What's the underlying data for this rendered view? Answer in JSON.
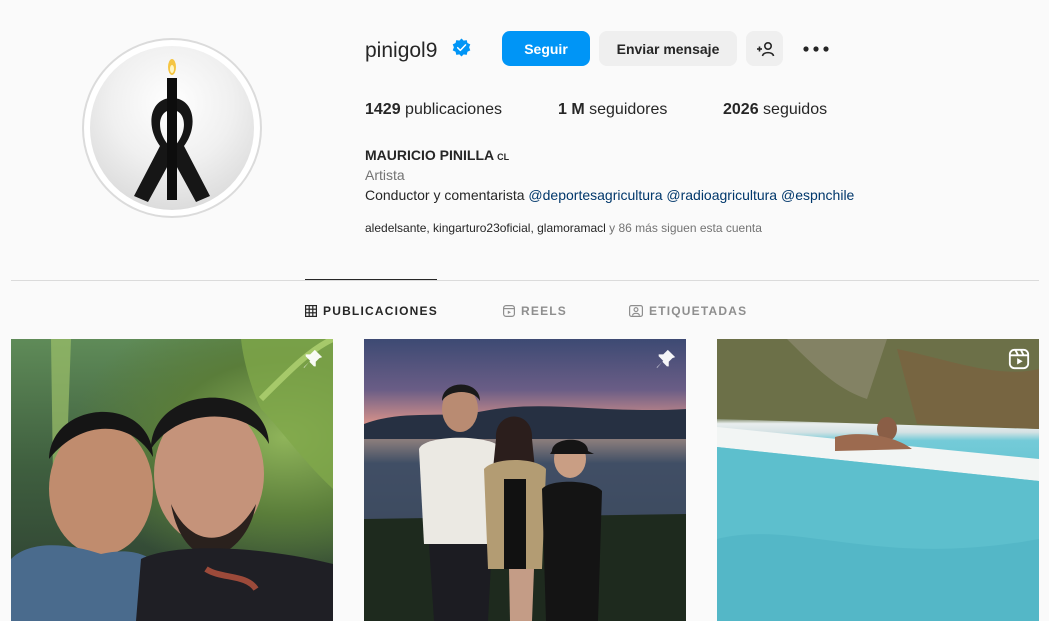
{
  "profile": {
    "username": "pinigol9",
    "follow_label": "Seguir",
    "message_label": "Enviar mensaje",
    "stats": {
      "posts_count": "1429",
      "posts_label": "publicaciones",
      "followers_count": "1 M",
      "followers_label": "seguidores",
      "following_count": "2026",
      "following_label": "seguidos"
    },
    "full_name": "MAURICIO PINILLA",
    "country_tag": "CL",
    "category": "Artista",
    "bio_text": "Conductor y comentarista",
    "bio_mentions": [
      "@deportesagricultura",
      "@radioagricultura",
      "@espnchile"
    ],
    "followed_by_names": "aledelsante, kingarturo23oficial, glamoramacl",
    "followed_by_suffix": "y 86 más siguen esta cuenta"
  },
  "tabs": [
    {
      "label": "PUBLICACIONES",
      "icon": "grid-icon",
      "active": true
    },
    {
      "label": "REELS",
      "icon": "reels-icon",
      "active": false
    },
    {
      "label": "ETIQUETADAS",
      "icon": "tagged-icon",
      "active": false
    }
  ],
  "posts": [
    {
      "badge": "pin-icon"
    },
    {
      "badge": "pin-icon"
    },
    {
      "badge": "reel-icon"
    }
  ],
  "colors": {
    "accent": "#0095f6",
    "verified": "#0095f6",
    "mention": "#00376b"
  }
}
